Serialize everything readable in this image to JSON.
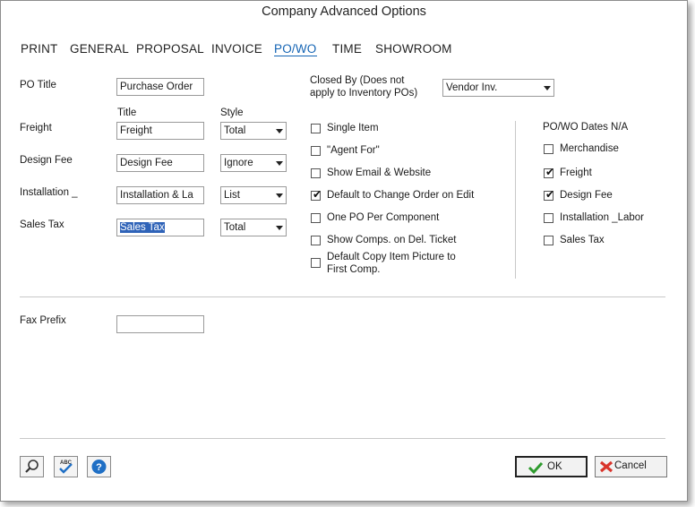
{
  "window": {
    "title": "Company Advanced Options"
  },
  "tabs": [
    {
      "label": "PRINT"
    },
    {
      "label": "GENERAL"
    },
    {
      "label": "PROPOSAL"
    },
    {
      "label": "INVOICE"
    },
    {
      "label": "PO/WO"
    },
    {
      "label": "TIME"
    },
    {
      "label": "SHOWROOM"
    }
  ],
  "active_tab": "PO/WO",
  "po_title": {
    "label": "PO Title",
    "value": "Purchase Order"
  },
  "closed_by": {
    "label_line1": "Closed By (Does not",
    "label_line2": "apply to Inventory POs)",
    "value": "Vendor Inv."
  },
  "columns": {
    "title": "Title",
    "style": "Style"
  },
  "rows": [
    {
      "label": "Freight",
      "title": "Freight",
      "style": "Total"
    },
    {
      "label": "Design Fee",
      "title": "Design Fee",
      "style": "Ignore"
    },
    {
      "label": "Installation _",
      "title": "Installation & La",
      "style": "List"
    },
    {
      "label": "Sales Tax",
      "title": "Sales Tax",
      "style": "Total"
    }
  ],
  "options": [
    {
      "label": "Single Item",
      "checked": false
    },
    {
      "label": "\"Agent For\"",
      "checked": false
    },
    {
      "label": "Show Email & Website",
      "checked": false
    },
    {
      "label": "Default to Change Order on Edit",
      "checked": true
    },
    {
      "label": "One PO Per Component",
      "checked": false
    },
    {
      "label": "Show Comps. on Del. Ticket",
      "checked": false
    },
    {
      "label_line1": "Default Copy Item Picture to",
      "label_line2": "First Comp.",
      "checked": false
    }
  ],
  "dates_na": {
    "heading": "PO/WO Dates N/A",
    "items": [
      {
        "label": "Merchandise",
        "checked": false
      },
      {
        "label": "Freight",
        "checked": true
      },
      {
        "label": "Design Fee",
        "checked": true
      },
      {
        "label": "Installation _Labor",
        "checked": false
      },
      {
        "label": "Sales Tax",
        "checked": false
      }
    ]
  },
  "fax_prefix": {
    "label": "Fax Prefix",
    "value": ""
  },
  "footer": {
    "icons": [
      "magnifier-icon",
      "spellcheck-icon",
      "help-icon"
    ],
    "spell_text": "ABC",
    "help_glyph": "?",
    "ok_label": "OK",
    "cancel_label": "Cancel"
  },
  "colors": {
    "accent": "#1464b4",
    "ok_green": "#2e9b2e",
    "cancel_red": "#d9342b",
    "selection": "#2f63b8"
  }
}
